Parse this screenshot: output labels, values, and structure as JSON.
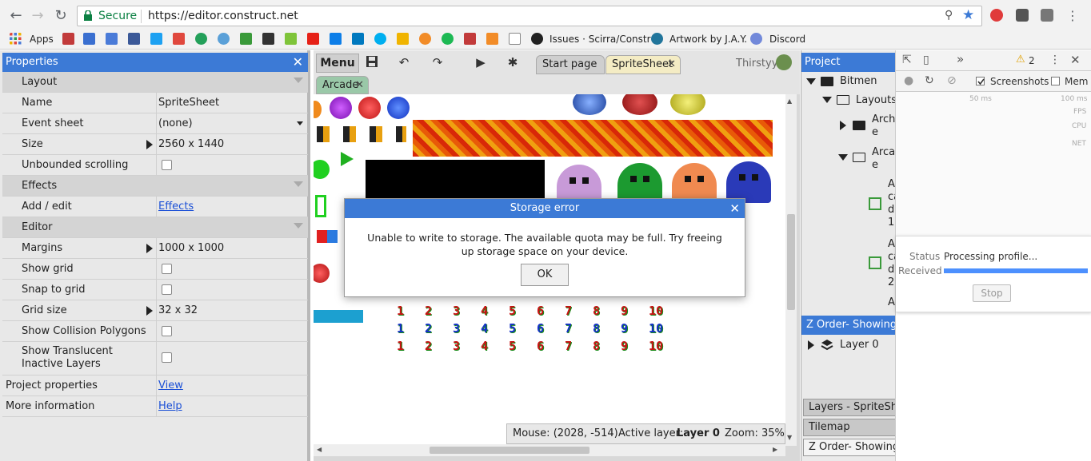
{
  "browser": {
    "secure_label": "Secure",
    "url": "https://editor.construct.net",
    "bookmarks": [
      {
        "label": "Apps"
      },
      {
        "label": "Issues · Scirra/Constr"
      },
      {
        "label": "Artwork by J.A.Y."
      },
      {
        "label": "Discord"
      }
    ]
  },
  "properties": {
    "title": "Properties",
    "rows": [
      {
        "type": "section",
        "label": "Layout"
      },
      {
        "type": "value",
        "label": "Name",
        "value": "SpriteSheet"
      },
      {
        "type": "dropdown",
        "label": "Event sheet",
        "value": "(none)"
      },
      {
        "type": "expand",
        "label": "Size",
        "value": "2560 x 1440"
      },
      {
        "type": "checkbox",
        "label": "Unbounded scrolling"
      },
      {
        "type": "section",
        "label": "Effects"
      },
      {
        "type": "link",
        "label": "Add / edit",
        "value": "Effects"
      },
      {
        "type": "section",
        "label": "Editor"
      },
      {
        "type": "expand",
        "label": "Margins",
        "value": "1000 x 1000"
      },
      {
        "type": "checkbox",
        "label": "Show grid"
      },
      {
        "type": "checkbox",
        "label": "Snap to grid"
      },
      {
        "type": "expand",
        "label": "Grid size",
        "value": "32 x 32"
      },
      {
        "type": "checkbox",
        "label": "Show Collision Polygons"
      },
      {
        "type": "checkbox2",
        "label": "Show Translucent Inactive Layers"
      },
      {
        "type": "plainlink",
        "label": "Project properties",
        "value": "View"
      },
      {
        "type": "plainlink",
        "label": "More information",
        "value": "Help"
      }
    ]
  },
  "editor": {
    "menu_label": "Menu",
    "tabs": [
      {
        "label": "Start page"
      },
      {
        "label": "SpriteSheet"
      }
    ],
    "layout_tab": "Arcade",
    "user": "Thirstyy",
    "status": {
      "mouse": "Mouse: (2028, -514)",
      "layer_prefix": "Active layer:",
      "layer": "Layer 0",
      "zoom": "Zoom: 35%"
    },
    "digits": [
      "1",
      "2",
      "3",
      "4",
      "5",
      "6",
      "7",
      "8",
      "9",
      "10"
    ]
  },
  "project": {
    "title": "Project",
    "root": "Bitmen",
    "layouts": "Layouts",
    "folder1": "Archi\ne",
    "folder2": "Arcad\ne",
    "item1": "A\nca\nd\n1",
    "item2": "A\nca\nd\n2",
    "item3": "A",
    "zorder_title": "Z Order- Showing ...",
    "layer": "Layer 0",
    "bottom_tabs": [
      "Layers - SpriteShee",
      "Tilemap",
      "Z Order- Showing ."
    ]
  },
  "devtools": {
    "warnings": "2",
    "screenshots": "Screenshots",
    "memory": "Mem",
    "ms50": "50 ms",
    "ms100": "100 ms",
    "fps": "FPS",
    "cpu": "CPU",
    "net": "NET",
    "status_label": "Status",
    "status_value": "Processing profile...",
    "received_label": "Received",
    "progress": 1.0,
    "stop_label": "Stop"
  },
  "modal": {
    "title": "Storage error",
    "message": "Unable to write to storage. The available quota may be full. Try freeing up storage space on your device.",
    "ok_label": "OK"
  }
}
